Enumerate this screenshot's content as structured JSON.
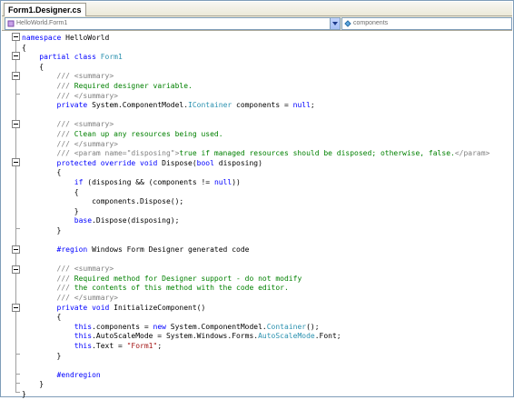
{
  "tab": {
    "label": "Form1.Designer.cs"
  },
  "nav": {
    "class_combo": "HelloWorld.Form1",
    "member_combo": "components"
  },
  "code_lines": [
    [
      [
        "k",
        "namespace"
      ],
      [
        "n",
        " HelloWorld"
      ]
    ],
    [
      [
        "n",
        "{"
      ]
    ],
    [
      [
        "n",
        "    "
      ],
      [
        "k",
        "partial class"
      ],
      [
        "n",
        " "
      ],
      [
        "t",
        "Form1"
      ]
    ],
    [
      [
        "n",
        "    {"
      ]
    ],
    [
      [
        "n",
        "        "
      ],
      [
        "d",
        "/// <summary>"
      ]
    ],
    [
      [
        "n",
        "        "
      ],
      [
        "d",
        "///"
      ],
      [
        "c",
        " Required designer variable."
      ]
    ],
    [
      [
        "n",
        "        "
      ],
      [
        "d",
        "/// </summary>"
      ]
    ],
    [
      [
        "n",
        "        "
      ],
      [
        "k",
        "private"
      ],
      [
        "n",
        " System.ComponentModel."
      ],
      [
        "t",
        "IContainer"
      ],
      [
        "n",
        " components = "
      ],
      [
        "k",
        "null"
      ],
      [
        "n",
        ";"
      ]
    ],
    [
      [
        "n",
        ""
      ]
    ],
    [
      [
        "n",
        "        "
      ],
      [
        "d",
        "/// <summary>"
      ]
    ],
    [
      [
        "n",
        "        "
      ],
      [
        "d",
        "///"
      ],
      [
        "c",
        " Clean up any resources being used."
      ]
    ],
    [
      [
        "n",
        "        "
      ],
      [
        "d",
        "/// </summary>"
      ]
    ],
    [
      [
        "n",
        "        "
      ],
      [
        "d",
        "/// <param name=\"disposing\">"
      ],
      [
        "c",
        "true if managed resources should be disposed; otherwise, false."
      ],
      [
        "d",
        "</param>"
      ]
    ],
    [
      [
        "n",
        "        "
      ],
      [
        "k",
        "protected override void"
      ],
      [
        "n",
        " Dispose("
      ],
      [
        "k",
        "bool"
      ],
      [
        "n",
        " disposing)"
      ]
    ],
    [
      [
        "n",
        "        {"
      ]
    ],
    [
      [
        "n",
        "            "
      ],
      [
        "k",
        "if"
      ],
      [
        "n",
        " (disposing && (components != "
      ],
      [
        "k",
        "null"
      ],
      [
        "n",
        "))"
      ]
    ],
    [
      [
        "n",
        "            {"
      ]
    ],
    [
      [
        "n",
        "                components.Dispose();"
      ]
    ],
    [
      [
        "n",
        "            }"
      ]
    ],
    [
      [
        "n",
        "            "
      ],
      [
        "k",
        "base"
      ],
      [
        "n",
        ".Dispose(disposing);"
      ]
    ],
    [
      [
        "n",
        "        }"
      ]
    ],
    [
      [
        "n",
        ""
      ]
    ],
    [
      [
        "n",
        "        "
      ],
      [
        "k",
        "#region"
      ],
      [
        "n",
        " Windows Form Designer generated code"
      ]
    ],
    [
      [
        "n",
        ""
      ]
    ],
    [
      [
        "n",
        "        "
      ],
      [
        "d",
        "/// <summary>"
      ]
    ],
    [
      [
        "n",
        "        "
      ],
      [
        "d",
        "///"
      ],
      [
        "c",
        " Required method for Designer support - do not modify"
      ]
    ],
    [
      [
        "n",
        "        "
      ],
      [
        "d",
        "///"
      ],
      [
        "c",
        " the contents of this method with the code editor."
      ]
    ],
    [
      [
        "n",
        "        "
      ],
      [
        "d",
        "/// </summary>"
      ]
    ],
    [
      [
        "n",
        "        "
      ],
      [
        "k",
        "private void"
      ],
      [
        "n",
        " InitializeComponent()"
      ]
    ],
    [
      [
        "n",
        "        {"
      ]
    ],
    [
      [
        "n",
        "            "
      ],
      [
        "k",
        "this"
      ],
      [
        "n",
        ".components = "
      ],
      [
        "k",
        "new"
      ],
      [
        "n",
        " System.ComponentModel."
      ],
      [
        "t",
        "Container"
      ],
      [
        "n",
        "();"
      ]
    ],
    [
      [
        "n",
        "            "
      ],
      [
        "k",
        "this"
      ],
      [
        "n",
        ".AutoScaleMode = System.Windows.Forms."
      ],
      [
        "t",
        "AutoScaleMode"
      ],
      [
        "n",
        ".Font;"
      ]
    ],
    [
      [
        "n",
        "            "
      ],
      [
        "k",
        "this"
      ],
      [
        "n",
        ".Text = "
      ],
      [
        "s",
        "\"Form1\""
      ],
      [
        "n",
        ";"
      ]
    ],
    [
      [
        "n",
        "        }"
      ]
    ],
    [
      [
        "n",
        ""
      ]
    ],
    [
      [
        "n",
        "        "
      ],
      [
        "k",
        "#endregion"
      ]
    ],
    [
      [
        "n",
        "    }"
      ]
    ],
    [
      [
        "n",
        "}"
      ]
    ]
  ]
}
